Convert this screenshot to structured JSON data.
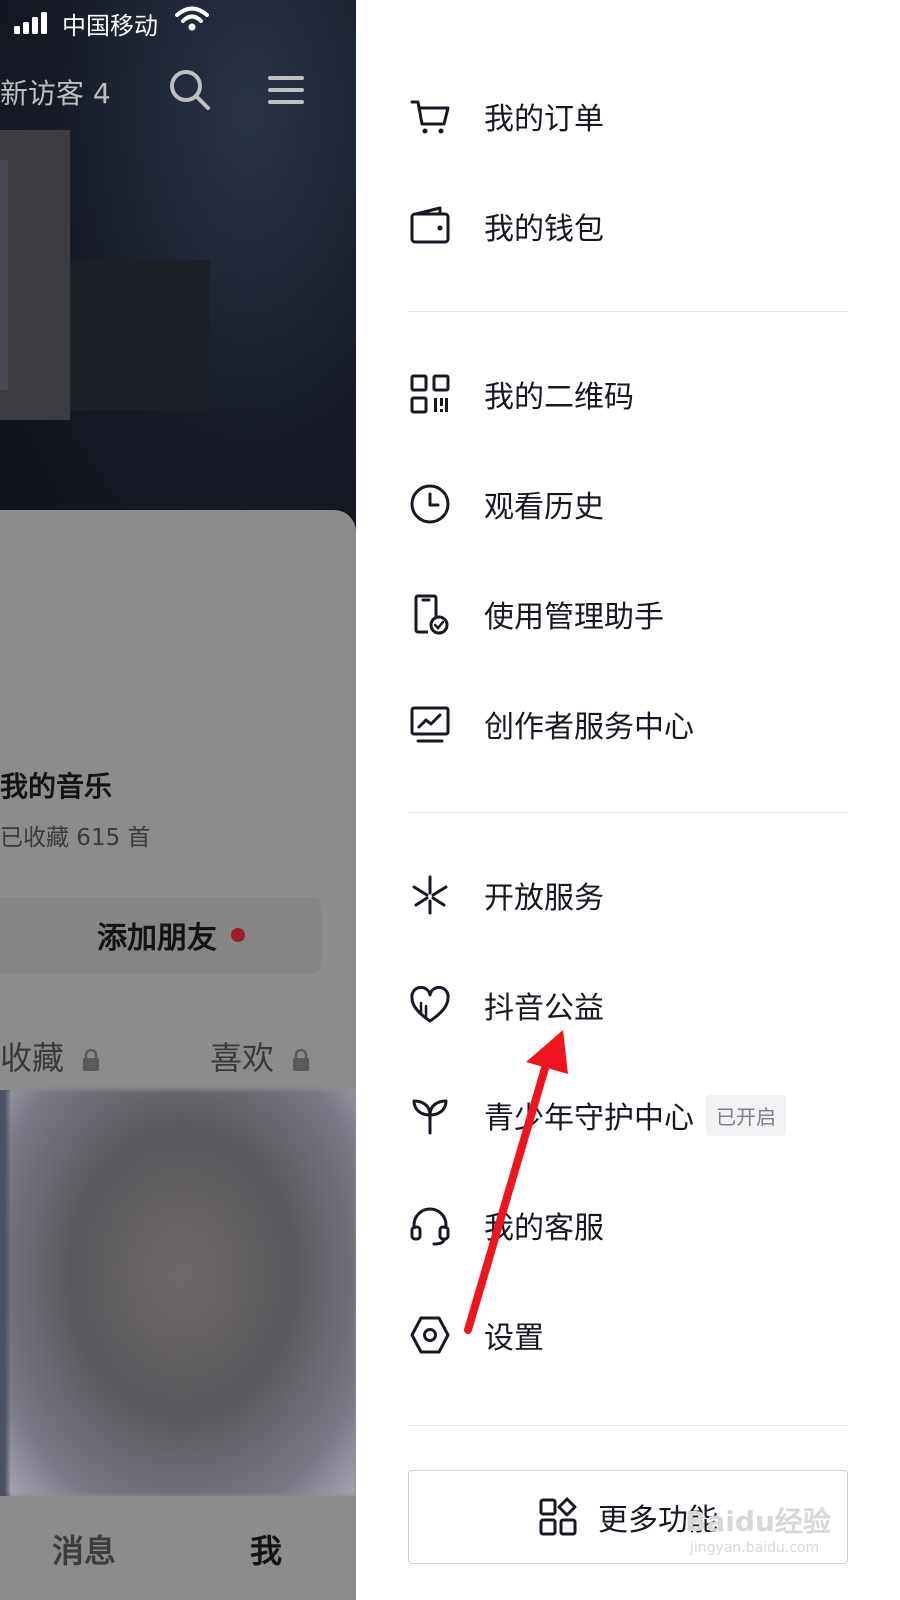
{
  "status_bar": {
    "carrier": "中国移动"
  },
  "profile": {
    "new_visitors": "新访客 4",
    "music_title": "我的音乐",
    "music_subtitle": "已收藏 615 首",
    "add_friend": "添加朋友",
    "tabs": {
      "favorites": "收藏",
      "likes": "喜欢"
    }
  },
  "bottom_nav": {
    "messages": "消息",
    "me": "我"
  },
  "drawer": {
    "group1": [
      {
        "label": "我的订单",
        "icon": "cart-icon"
      },
      {
        "label": "我的钱包",
        "icon": "wallet-icon"
      }
    ],
    "group2": [
      {
        "label": "我的二维码",
        "icon": "qr-code-icon"
      },
      {
        "label": "观看历史",
        "icon": "clock-icon"
      },
      {
        "label": "使用管理助手",
        "icon": "phone-check-icon"
      },
      {
        "label": "创作者服务中心",
        "icon": "monitor-chart-icon"
      }
    ],
    "group3": [
      {
        "label": "开放服务",
        "icon": "spark-icon"
      },
      {
        "label": "抖音公益",
        "icon": "heart-icon"
      },
      {
        "label": "青少年守护中心",
        "icon": "sprout-icon",
        "badge": "已开启"
      },
      {
        "label": "我的客服",
        "icon": "headset-icon"
      },
      {
        "label": "设置",
        "icon": "hex-settings-icon"
      }
    ],
    "more_button": "更多功能"
  },
  "watermark": {
    "text": "Baidu经验",
    "sub": "jingyan.baidu.com"
  },
  "colors": {
    "annotation_arrow": "#f0141e",
    "text": "#161823",
    "badge_bg": "#f2f2f4"
  }
}
